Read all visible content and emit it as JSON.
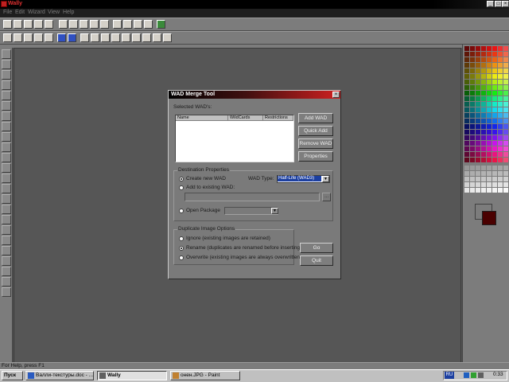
{
  "window": {
    "title": "Wally",
    "min": "_",
    "max": "□",
    "close": "×"
  },
  "menu": [
    "File",
    "Edit",
    "Wizard",
    "View",
    "Help"
  ],
  "dialog": {
    "title": "WAD Merge Tool",
    "close": "×",
    "selected_wads_label": "Selected WAD's:",
    "columns": [
      "Name",
      "WildCards",
      "Restrictions"
    ],
    "buttons": {
      "add_wad": "Add WAD",
      "quick_add": "Quick Add",
      "remove_wad": "Remove WAD",
      "properties": "Properties",
      "go": "Go",
      "quit": "Quit"
    },
    "destination": {
      "title": "Destination Properties",
      "create_new": "Create new WAD",
      "add_existing": "Add to existing WAD:",
      "open_package": "Open Package",
      "wad_type_label": "WAD Type:",
      "wad_type_value": "Half-Life (WAD3)",
      "browse": "..."
    },
    "duplicates": {
      "title": "Duplicate Image Options",
      "ignore": "Ignore (existing images are retained)",
      "rename": "Rename (duplicates are renamed before inserting)",
      "overwrite": "Overwrite (existing images are always overwritten)"
    }
  },
  "status": {
    "text": "For Help, press F1"
  },
  "taskbar": {
    "start": "Пуск",
    "tasks": [
      "Валли-текстуры.doc - ...",
      "Wally",
      "онен.JPG - Paint"
    ],
    "lang": "RU",
    "clock": "0:33"
  },
  "colors": {
    "accent_title": "#d02020",
    "selection": "#1c3fa0"
  }
}
